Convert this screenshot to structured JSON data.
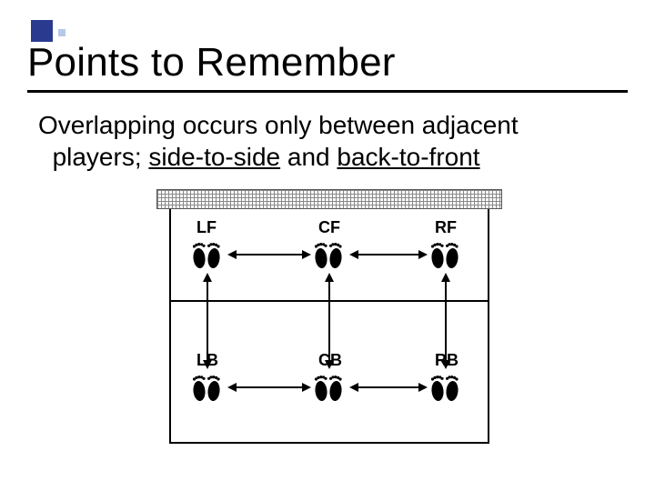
{
  "title": "Points to Remember",
  "body": {
    "line1": "Overlapping occurs only between adjacent",
    "line2_pre": "players; ",
    "line2_u1": "side-to-side",
    "line2_mid": " and  ",
    "line2_u2": "back-to-front"
  },
  "positions": {
    "LF": "LF",
    "CF": "CF",
    "RF": "RF",
    "LB": "LB",
    "CB": "CB",
    "RB": "RB"
  }
}
